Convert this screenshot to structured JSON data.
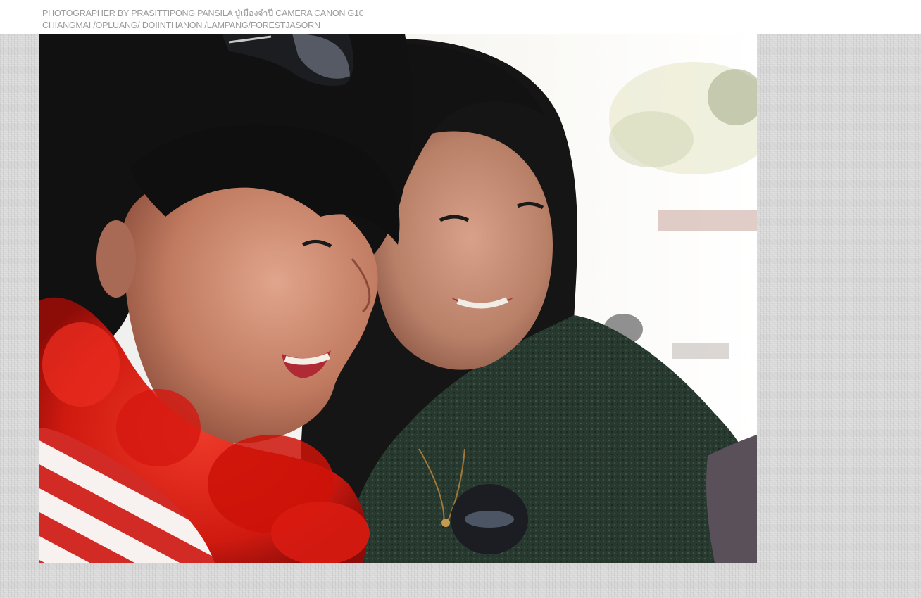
{
  "caption": {
    "line1": "PHOTOGRAPHER BY PRASITTIPONG PANSILA ปู่เมืองจ๋าปี CAMERA CANON G10",
    "line2": "CHIANGMAI /OPLUANG/ DOIINTHANON /LAMPANG/FORESTJASORN"
  },
  "photo": {
    "subject": "two smiling women looking down together",
    "colors": {
      "background": "#f4f2ee",
      "hair": "#141414",
      "skin_left": "#c07a60",
      "skin_right": "#b98068",
      "red_scarf": "#d81b12",
      "stripes_red": "#d22a24",
      "sweater": "#2a3a30",
      "sleeve": "#5a505a"
    }
  }
}
